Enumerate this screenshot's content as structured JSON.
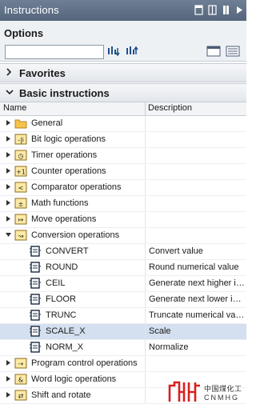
{
  "titlebar": {
    "title": "Instructions",
    "icons": [
      "panel-icon",
      "dock-icon",
      "pin-icon",
      "collapse-icon"
    ]
  },
  "options": {
    "label": "Options",
    "search_value": "",
    "search_placeholder": ""
  },
  "favorites": {
    "label": "Favorites"
  },
  "basic": {
    "label": "Basic instructions"
  },
  "columns": {
    "name": "Name",
    "description": "Description"
  },
  "rows": [
    {
      "label": "General",
      "description": "",
      "icon": "folder-icon",
      "expand": "collapsed",
      "level": 0
    },
    {
      "label": "Bit logic operations",
      "description": "",
      "icon": "bit-logic-icon",
      "expand": "collapsed",
      "level": 0
    },
    {
      "label": "Timer operations",
      "description": "",
      "icon": "timer-icon",
      "expand": "collapsed",
      "level": 0
    },
    {
      "label": "Counter operations",
      "description": "",
      "icon": "counter-icon",
      "expand": "collapsed",
      "level": 0
    },
    {
      "label": "Comparator operations",
      "description": "",
      "icon": "comparator-icon",
      "expand": "collapsed",
      "level": 0
    },
    {
      "label": "Math functions",
      "description": "",
      "icon": "math-icon",
      "expand": "collapsed",
      "level": 0
    },
    {
      "label": "Move operations",
      "description": "",
      "icon": "move-icon",
      "expand": "collapsed",
      "level": 0
    },
    {
      "label": "Conversion operations",
      "description": "",
      "icon": "conversion-icon",
      "expand": "expanded",
      "level": 0
    },
    {
      "label": "CONVERT",
      "description": "Convert value",
      "icon": "instruction-icon",
      "expand": "none",
      "level": 1
    },
    {
      "label": "ROUND",
      "description": "Round numerical value",
      "icon": "instruction-icon",
      "expand": "none",
      "level": 1
    },
    {
      "label": "CEIL",
      "description": "Generate next higher integer",
      "icon": "instruction-icon",
      "expand": "none",
      "level": 1
    },
    {
      "label": "FLOOR",
      "description": "Generate next lower integer",
      "icon": "instruction-icon",
      "expand": "none",
      "level": 1
    },
    {
      "label": "TRUNC",
      "description": "Truncate numerical value",
      "icon": "instruction-icon",
      "expand": "none",
      "level": 1
    },
    {
      "label": "SCALE_X",
      "description": "Scale",
      "icon": "instruction-icon",
      "expand": "none",
      "level": 1,
      "selected": true
    },
    {
      "label": "NORM_X",
      "description": "Normalize",
      "icon": "instruction-icon",
      "expand": "none",
      "level": 1
    },
    {
      "label": "Program control operations",
      "description": "",
      "icon": "program-control-icon",
      "expand": "collapsed",
      "level": 0
    },
    {
      "label": "Word logic operations",
      "description": "",
      "icon": "word-logic-icon",
      "expand": "collapsed",
      "level": 0
    },
    {
      "label": "Shift and rotate",
      "description": "",
      "icon": "shift-rotate-icon",
      "expand": "collapsed",
      "level": 0
    }
  ],
  "watermark": {
    "zh": "中国煤化工",
    "en": "CNMHG"
  },
  "colors": {
    "title_bg": "#5f7089",
    "selected_bg": "#d4e0ef",
    "logo_red": "#d8201f"
  }
}
